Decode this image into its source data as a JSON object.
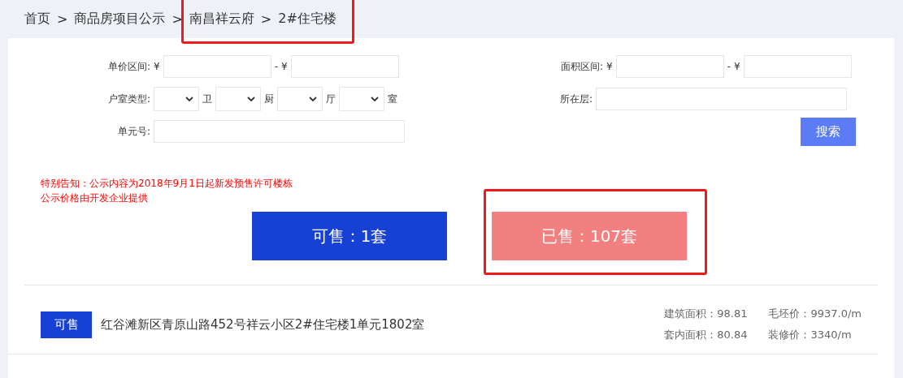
{
  "breadcrumb": [
    {
      "label": "首页",
      "highlighted": false
    },
    {
      "label": "商品房项目公示",
      "highlighted": false
    },
    {
      "label": "南昌祥云府",
      "highlighted": true
    },
    {
      "label": "2#住宅楼",
      "highlighted": true
    }
  ],
  "breadcrumb_separator": ">",
  "filters": {
    "price": {
      "label": "单价区间:",
      "currency": "¥",
      "dash": "-"
    },
    "layout": {
      "label": "户室类型:",
      "units": [
        "卫",
        "厨",
        "厅",
        "室"
      ]
    },
    "unit_no": {
      "label": "单元号:"
    },
    "area": {
      "label": "面积区间:",
      "currency": "¥",
      "dash": "-"
    },
    "floor": {
      "label": "所在层:"
    },
    "search_button": "搜索"
  },
  "notice": [
    "特别告知：公示内容为2018年9月1日起新发预售许可楼栋",
    "公示价格由开发企业提供"
  ],
  "stats": [
    {
      "label": "可售：1套",
      "kind": "available",
      "highlighted": false
    },
    {
      "label": "已售：107套",
      "kind": "sold",
      "highlighted": true
    }
  ],
  "listings": [
    {
      "status": "可售",
      "address": "红谷滩新区青原山路452号祥云小区2#住宅楼1单元1802室",
      "details": [
        [
          "建筑面积：98.81",
          "毛坯价：9937.0/m"
        ],
        [
          "套内面积：80.84",
          "装修价：3340/m"
        ]
      ]
    }
  ]
}
